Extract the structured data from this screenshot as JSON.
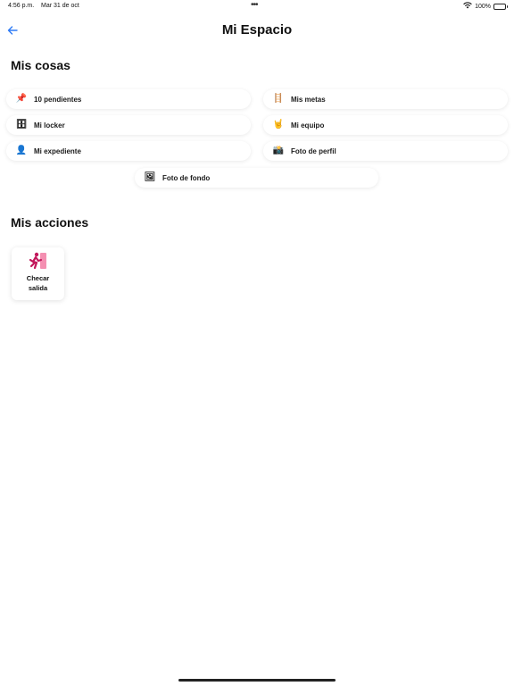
{
  "status_bar": {
    "time": "4:56 p.m.",
    "date": "Mar 31 de oct",
    "battery": "100%"
  },
  "header": {
    "title": "Mi Espacio"
  },
  "mis_cosas": {
    "title": "Mis cosas",
    "items": [
      {
        "label": "10 pendientes",
        "icon": "pushpin-icon",
        "glyph": "📌"
      },
      {
        "label": "Mis metas",
        "icon": "path-icon",
        "glyph": "🪜"
      },
      {
        "label": "Mi locker",
        "icon": "locker-icon",
        "glyph": "🗄"
      },
      {
        "label": "Mi equipo",
        "icon": "rock-hand-icon",
        "glyph": "🤘"
      },
      {
        "label": "Mi expediente",
        "icon": "user-silhouette-icon",
        "glyph": "👤"
      },
      {
        "label": "Foto de perfil",
        "icon": "camera-flash-icon",
        "glyph": "📸"
      },
      {
        "label": "Foto de fondo",
        "icon": "landscape-picture-icon",
        "glyph": "🖼"
      }
    ]
  },
  "mis_acciones": {
    "title": "Mis acciones",
    "actions": [
      {
        "label_line1": "Checar",
        "label_line2": "salida",
        "icon": "exit-door-icon"
      }
    ]
  },
  "colors": {
    "accent": "#2f7bf6",
    "action_icon": "#c2185b",
    "action_icon_light": "#f06292"
  }
}
